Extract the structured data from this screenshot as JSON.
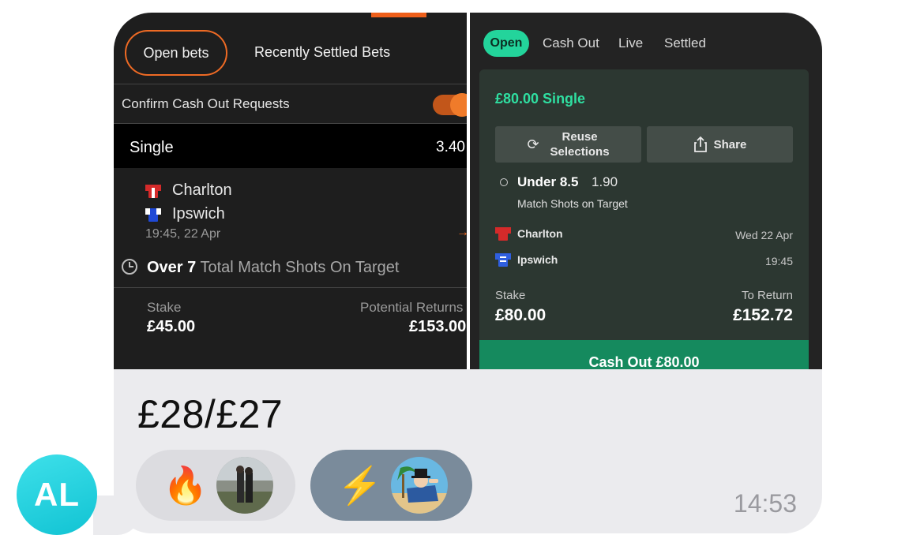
{
  "sender": {
    "initials": "AL"
  },
  "left_screenshot": {
    "tabs": {
      "open": "Open bets",
      "recent": "Recently Settled Bets"
    },
    "confirm_label": "Confirm Cash Out Requests",
    "bet_type": "Single",
    "odds": "3.40",
    "home_team": "Charlton",
    "away_team": "Ipswich",
    "kickoff": "19:45, 22 Apr",
    "arrow": "→",
    "market_bold": "Over 7",
    "market_rest": " Total Match Shots On Target",
    "stake_label": "Stake",
    "stake_value": "£45.00",
    "returns_label": "Potential Returns",
    "returns_value": "£153.00"
  },
  "right_screenshot": {
    "tabs": {
      "open": "Open",
      "cash_out": "Cash Out",
      "live": "Live",
      "settled": "Settled"
    },
    "title": "£80.00  Single",
    "reuse_label_1": "Reuse",
    "reuse_label_2": "Selections",
    "share_label": "Share",
    "selection": "Under 8.5",
    "selection_odds": "1.90",
    "market": "Match Shots on Target",
    "home_team": "Charlton",
    "away_team": "Ipswich",
    "date": "Wed 22 Apr",
    "time": "19:45",
    "stake_label": "Stake",
    "stake_value": "£80.00",
    "return_label": "To Return",
    "return_value": "£152.72",
    "cash_out_label": "Cash Out  £80.00"
  },
  "message": {
    "text": "£28/£27",
    "time": "14:53"
  },
  "reactions": [
    {
      "emoji": "🔥"
    },
    {
      "emoji": "⚡"
    }
  ],
  "colors": {
    "accent_orange": "#ee6a24",
    "accent_green": "#23d49b",
    "cash_out_green": "#158a5e",
    "avatar": "#1fd0dc"
  }
}
